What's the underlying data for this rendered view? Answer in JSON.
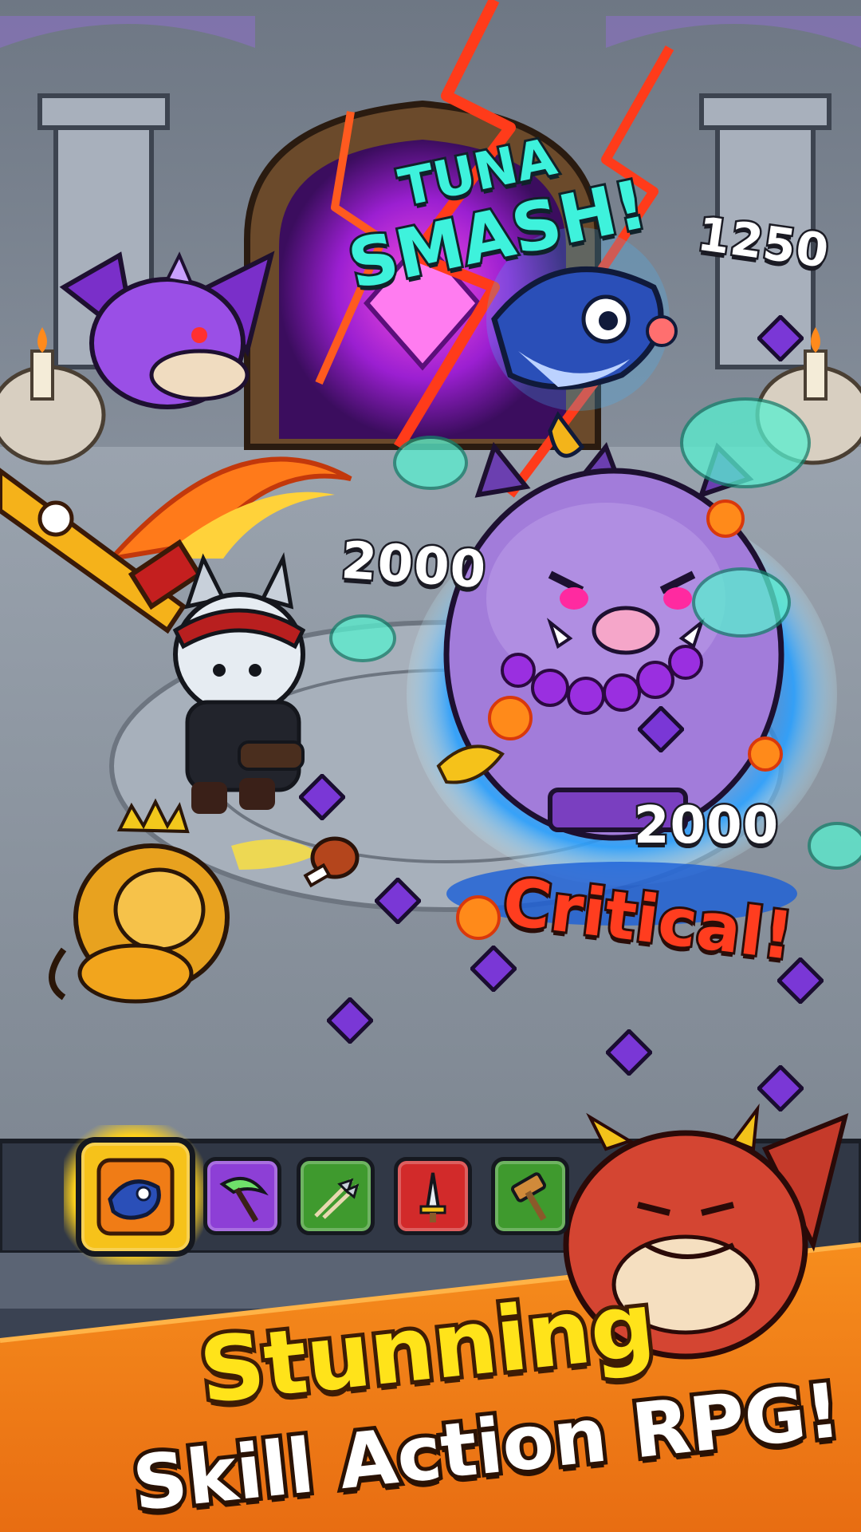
{
  "popups": {
    "skill_name_line1": "TUNA",
    "skill_name_line2": "SMASH!",
    "damage_1": "1250",
    "damage_2": "2000",
    "damage_3": "2000",
    "critical": "Critical!"
  },
  "skill_bar": {
    "slots": [
      {
        "name": "tuna-smash",
        "icon": "tuna-fish-icon",
        "color": "#f6c21a",
        "active": true
      },
      {
        "name": "scythe",
        "icon": "scythe-icon",
        "color": "#8d3fd6",
        "active": false
      },
      {
        "name": "arrow-rain",
        "icon": "arrows-icon",
        "color": "#3f9a2e",
        "active": false
      },
      {
        "name": "holy-sword",
        "icon": "sword-icon",
        "color": "#d22a2a",
        "active": false
      },
      {
        "name": "hammer",
        "icon": "hammer-icon",
        "color": "#3f9a2e",
        "active": false
      }
    ]
  },
  "banner": {
    "headline": "Stunning",
    "subtitle": "Skill Action RPG!"
  },
  "colors": {
    "accent_yellow": "#ffe31a",
    "critical_red": "#ff3d1f",
    "skill_cyan": "#3ef2dc",
    "banner_orange": "#f07c16"
  }
}
